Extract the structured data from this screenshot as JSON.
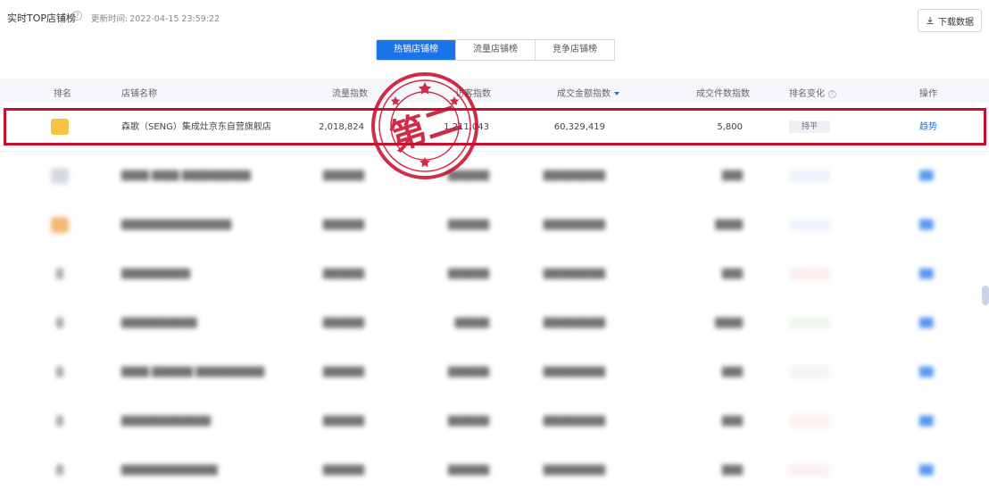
{
  "header": {
    "title": "实时TOP店铺榜",
    "update_label": "更新时间:",
    "update_time": "2022-04-15 23:59:22",
    "download_label": "下载数据"
  },
  "tabs": [
    {
      "label": "热销店铺榜",
      "active": true
    },
    {
      "label": "流量店铺榜",
      "active": false
    },
    {
      "label": "竞争店铺榜",
      "active": false
    }
  ],
  "columns": [
    "排名",
    "店铺名称",
    "流量指数",
    "访客指数",
    "成交金额指数",
    "成交件数指数",
    "排名变化",
    "操作"
  ],
  "rows": [
    {
      "rank": "1",
      "name": "森歌（SENG）集成灶京东自营旗舰店",
      "traffic": "2,018,824",
      "visitors": "1,211,043",
      "amount": "60,329,419",
      "count": "5,800",
      "change": "持平",
      "op": "趋势"
    }
  ],
  "stamp": {
    "text": "第二",
    "color": "#c8102e"
  },
  "colors": {
    "accent": "#1b73e8",
    "highlight": "#c8102e"
  }
}
